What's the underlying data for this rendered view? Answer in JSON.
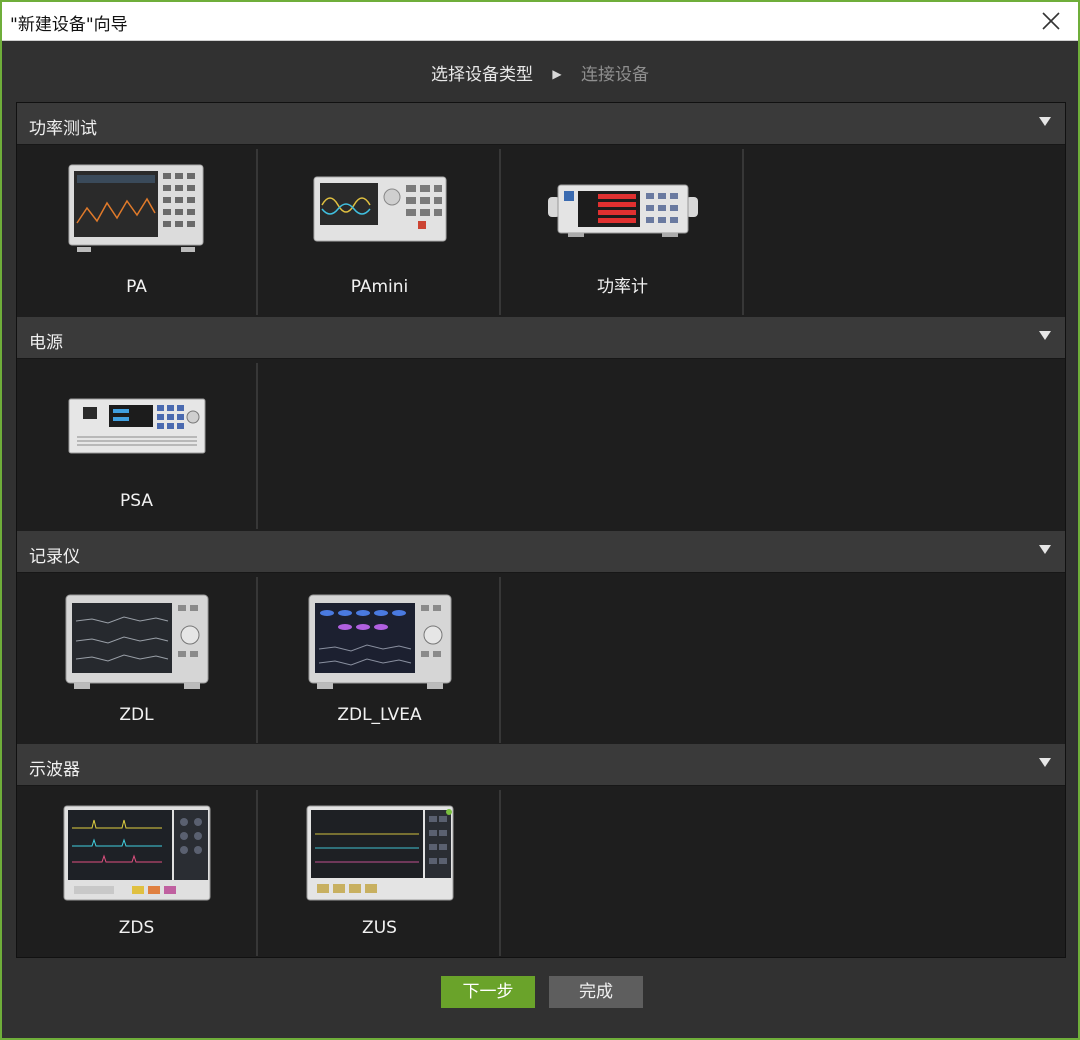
{
  "window": {
    "title": "\"新建设备\"向导"
  },
  "steps": {
    "step1": "选择设备类型",
    "step2": "连接设备"
  },
  "sections": [
    {
      "title": "功率测试",
      "devices": [
        "PA",
        "PAmini",
        "功率计"
      ]
    },
    {
      "title": "电源",
      "devices": [
        "PSA"
      ]
    },
    {
      "title": "记录仪",
      "devices": [
        "ZDL",
        "ZDL_LVEA"
      ]
    },
    {
      "title": "示波器",
      "devices": [
        "ZDS",
        "ZUS"
      ]
    }
  ],
  "buttons": {
    "next": "下一步",
    "finish": "完成"
  },
  "colors": {
    "accent": "#6aa32a",
    "window_border": "#6fae3a"
  }
}
